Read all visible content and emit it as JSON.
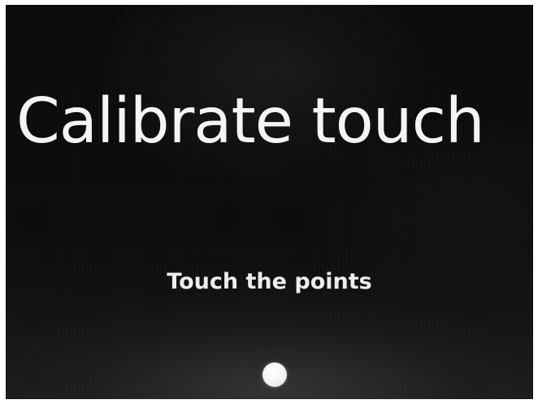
{
  "screen": {
    "title": "Calibrate touch",
    "instruction": "Touch the points",
    "calibration_point": {
      "icon": "touch-target-dot",
      "color": "#ffffff"
    }
  },
  "colors": {
    "background": "#0b0b0b",
    "text": "#f4f4f4",
    "bezel": "#ffffff"
  }
}
